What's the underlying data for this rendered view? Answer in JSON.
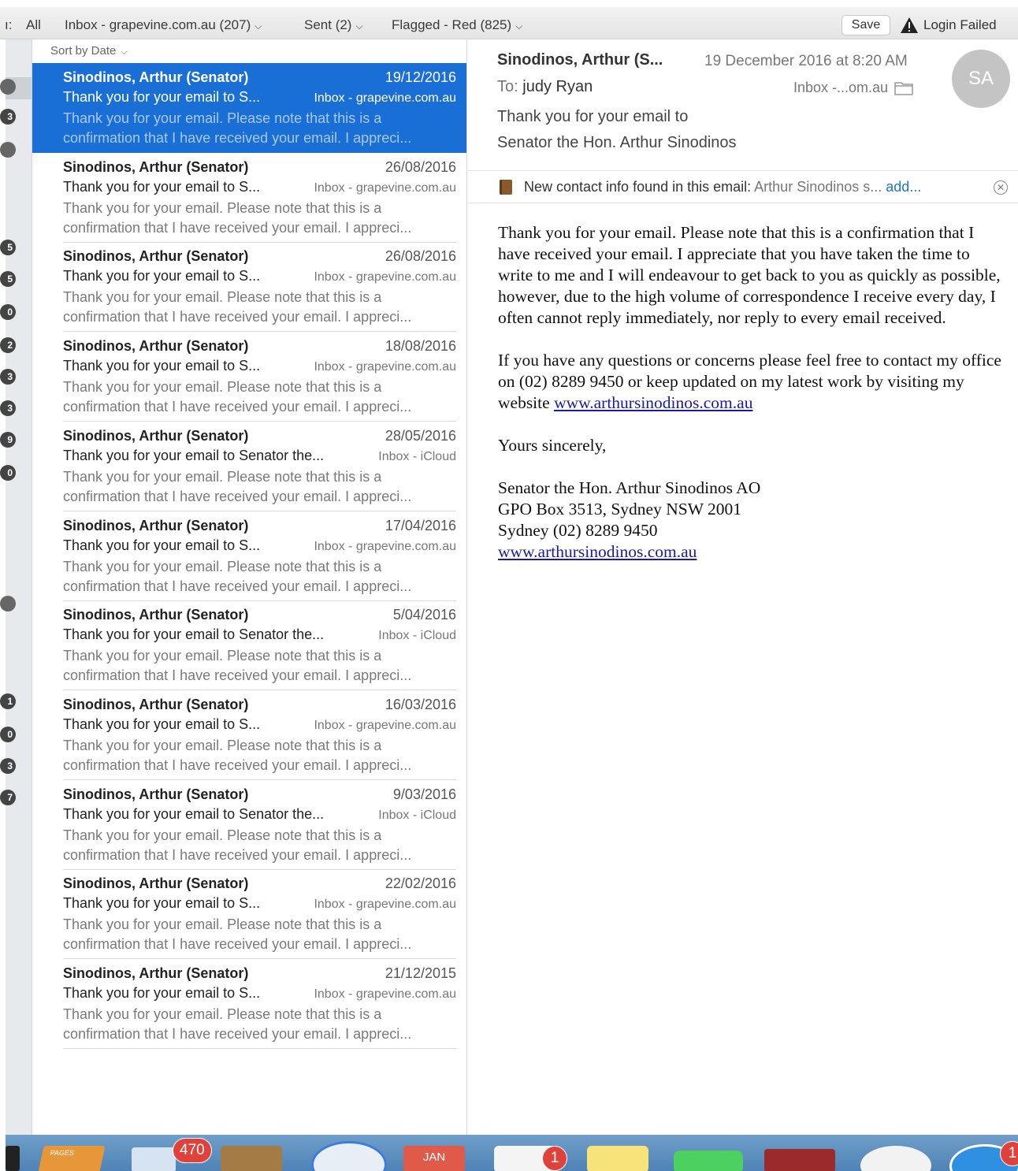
{
  "favorites_bar": {
    "items": [
      {
        "label": "All",
        "prefix": "ı:",
        "has_menu": false
      },
      {
        "label": "Inbox - grapevine.com.au (207)",
        "has_menu": true
      },
      {
        "label": "Sent (2)",
        "has_menu": true
      },
      {
        "label": "Flagged - Red (825)",
        "has_menu": true
      }
    ],
    "save_label": "Save",
    "status_label": "Login Failed"
  },
  "sort": {
    "label": "Sort by Date"
  },
  "messages": [
    {
      "sender": "Sinodinos, Arthur (Senator)",
      "date": "19/12/2016",
      "subject": "Thank you for your email to S...",
      "mailbox": "Inbox - grapevine.com.au",
      "preview1": "Thank you for your email. Please note that this is a",
      "preview2": "confirmation that I have received your email. I appreci...",
      "selected": true
    },
    {
      "sender": "Sinodinos, Arthur (Senator)",
      "date": "26/08/2016",
      "subject": "Thank you for your email to S...",
      "mailbox": "Inbox - grapevine.com.au",
      "preview1": "Thank you for your email. Please note that this is a",
      "preview2": "confirmation that I have received your email. I appreci..."
    },
    {
      "sender": "Sinodinos, Arthur (Senator)",
      "date": "26/08/2016",
      "subject": "Thank you for your email to S...",
      "mailbox": "Inbox - grapevine.com.au",
      "preview1": "Thank you for your email. Please note that this is a",
      "preview2": "confirmation that I have received your email. I appreci..."
    },
    {
      "sender": "Sinodinos, Arthur (Senator)",
      "date": "18/08/2016",
      "subject": "Thank you for your email to S...",
      "mailbox": "Inbox - grapevine.com.au",
      "preview1": "Thank you for your email. Please note that this is a",
      "preview2": "confirmation that I have received your email. I appreci..."
    },
    {
      "sender": "Sinodinos, Arthur (Senator)",
      "date": "28/05/2016",
      "subject": "Thank you for your email to Senator the...",
      "mailbox": "Inbox - iCloud",
      "preview1": "Thank you for your email. Please note that this is a",
      "preview2": "confirmation that I have received your email. I appreci..."
    },
    {
      "sender": "Sinodinos, Arthur (Senator)",
      "date": "17/04/2016",
      "subject": "Thank you for your email to S...",
      "mailbox": "Inbox - grapevine.com.au",
      "preview1": "Thank you for your email. Please note that this is a",
      "preview2": "confirmation that I have received your email. I appreci..."
    },
    {
      "sender": "Sinodinos, Arthur (Senator)",
      "date": "5/04/2016",
      "subject": "Thank you for your email to Senator the...",
      "mailbox": "Inbox - iCloud",
      "preview1": "Thank you for your email. Please note that this is a",
      "preview2": "confirmation that I have received your email. I appreci..."
    },
    {
      "sender": "Sinodinos, Arthur (Senator)",
      "date": "16/03/2016",
      "subject": "Thank you for your email to S...",
      "mailbox": "Inbox - grapevine.com.au",
      "preview1": "Thank you for your email. Please note that this is a",
      "preview2": "confirmation that I have received your email. I appreci..."
    },
    {
      "sender": "Sinodinos, Arthur (Senator)",
      "date": "9/03/2016",
      "subject": "Thank you for your email to Senator the...",
      "mailbox": "Inbox - iCloud",
      "preview1": "Thank you for your email. Please note that this is a",
      "preview2": "confirmation that I have received your email. I appreci..."
    },
    {
      "sender": "Sinodinos, Arthur (Senator)",
      "date": "22/02/2016",
      "subject": "Thank you for your email to S...",
      "mailbox": "Inbox - grapevine.com.au",
      "preview1": "Thank you for your email. Please note that this is a",
      "preview2": "confirmation that I have received your email. I appreci..."
    },
    {
      "sender": "Sinodinos, Arthur (Senator)",
      "date": "21/12/2015",
      "subject": "Thank you for your email to S...",
      "mailbox": "Inbox - grapevine.com.au",
      "preview1": "Thank you for your email. Please note that this is a",
      "preview2": "confirmation that I have received your email. I appreci..."
    }
  ],
  "reader": {
    "sender": "Sinodinos, Arthur (S...",
    "date": "19 December 2016 at 8:20 AM",
    "to_label": "To:",
    "to_name": "judy Ryan",
    "mailbox": "Inbox -...om.au",
    "avatar_initials": "SA",
    "subject_line1": "Thank you for your email to",
    "subject_line2": "Senator the Hon. Arthur Sinodinos",
    "contact_banner": {
      "label": "New contact info found in this email:",
      "value": "Arthur Sinodinos s...",
      "action": "add..."
    },
    "body": {
      "p1": "Thank you for your email. Please note that this is a confirmation that I have received your email. I appreciate that you have taken the time to write to me and I will endeavour to get back to you as quickly as possible, however, due to the high volume of correspondence I receive every day, I often cannot reply immediately, nor reply to every email received.",
      "p2_text": "If you have any questions or concerns please feel free to contact my office on (02) 8289 9450 or keep updated on my latest work by visiting my website",
      "p2_link": "www.arthursinodinos.com.au",
      "closing": "Yours sincerely,",
      "sig_name": "Senator the Hon. Arthur Sinodinos AO",
      "sig_address": "GPO Box 3513, Sydney NSW 2001",
      "sig_phone": "Sydney (02) 8289 9450",
      "sig_link": "www.arthursinodinos.com.au"
    }
  },
  "left_strip": {
    "badges": [
      "",
      "3",
      "",
      "5",
      "5",
      "0",
      "2",
      "3",
      "3",
      "9",
      "0",
      "",
      "1",
      "0",
      "3",
      "7"
    ]
  },
  "dock": {
    "badges": {
      "mail": "470",
      "reminders": "1",
      "appstore": "1"
    },
    "calendar_month": "JAN",
    "pages_label": "PAGES"
  },
  "colors": {
    "selection": "#1a6fd6",
    "link": "#1a73d9",
    "badge": "#e0413a"
  }
}
